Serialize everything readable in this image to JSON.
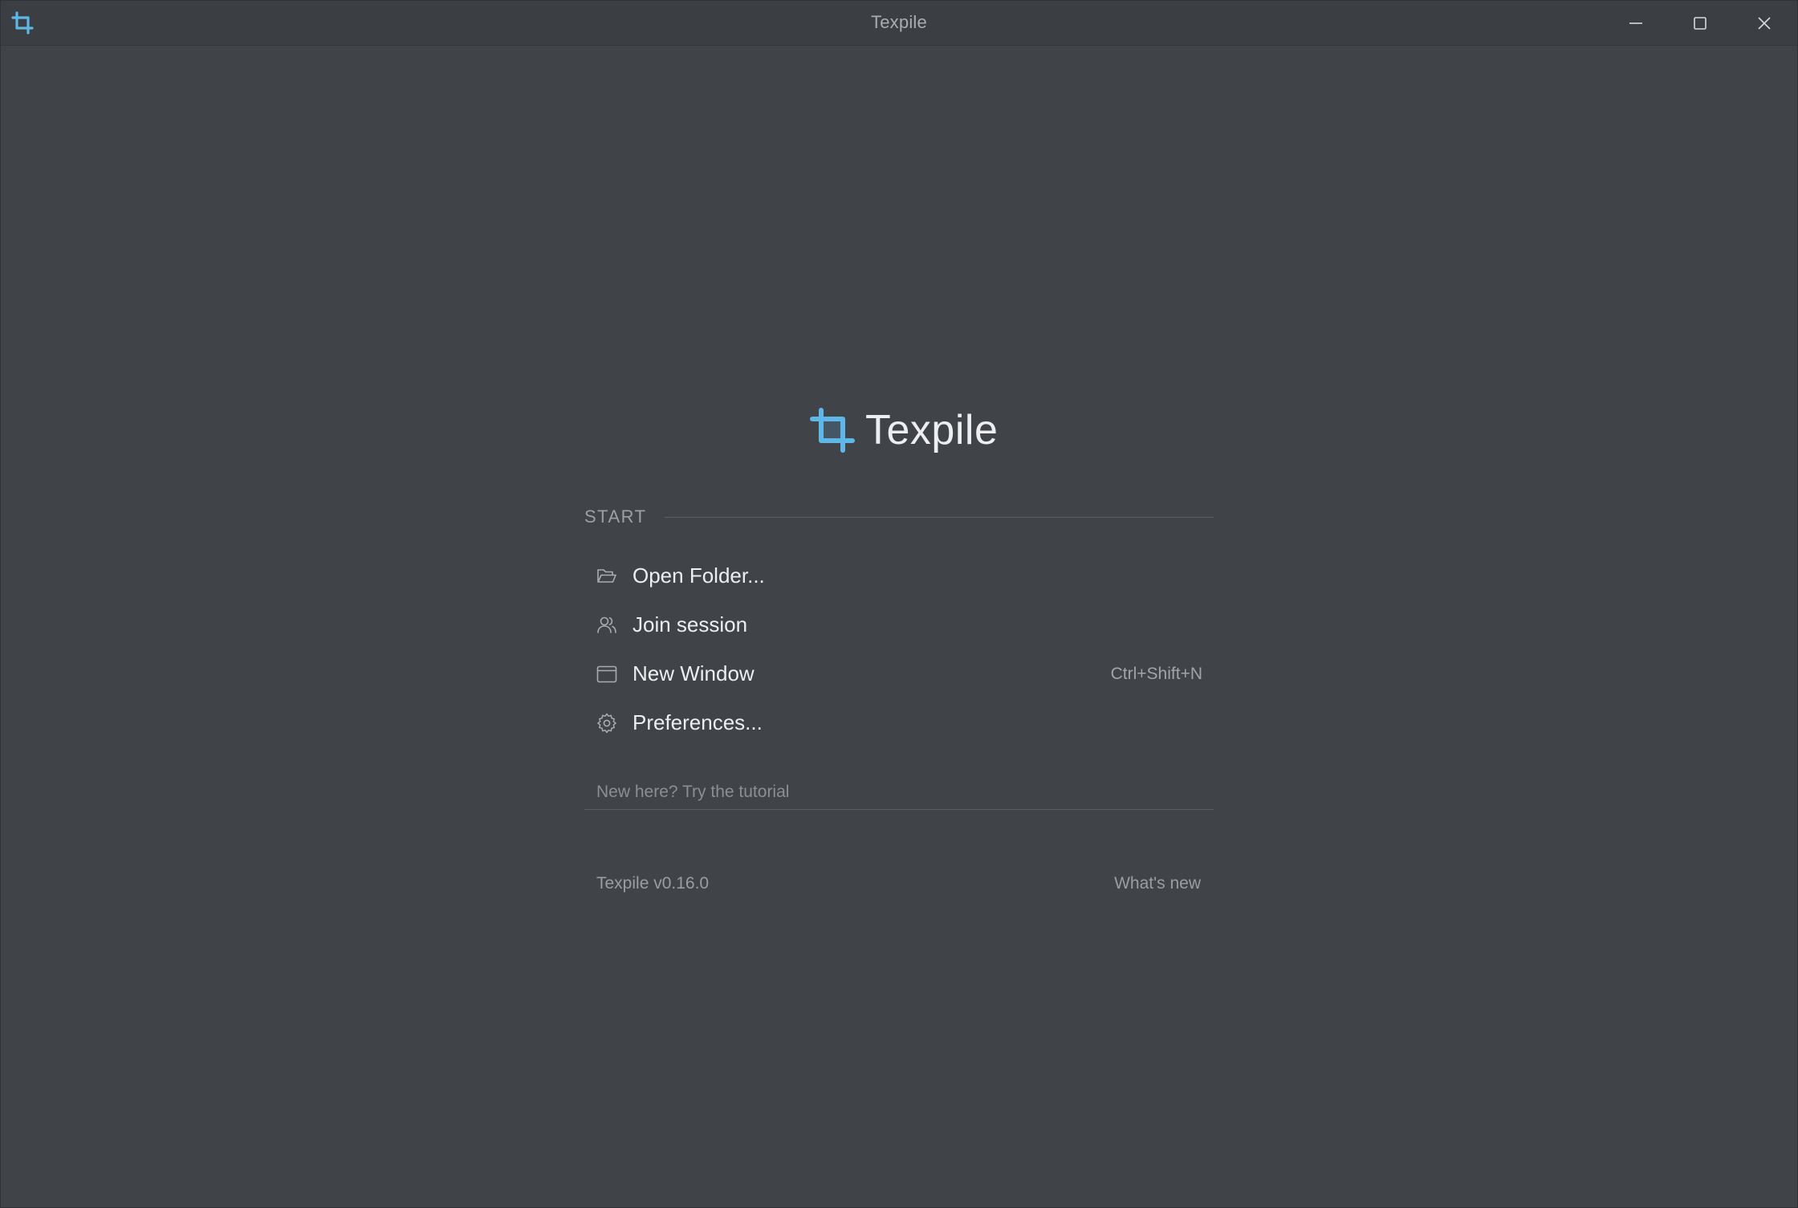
{
  "window": {
    "title": "Texpile",
    "icons": {
      "app": "crop-logo-icon",
      "minimize": "minimize-icon",
      "maximize": "maximize-icon",
      "close": "close-icon"
    }
  },
  "welcome": {
    "app_name": "Texpile",
    "start_section_label": "START",
    "items": [
      {
        "label": "Open Folder...",
        "icon": "folder-open-icon",
        "shortcut": ""
      },
      {
        "label": "Join session",
        "icon": "users-icon",
        "shortcut": ""
      },
      {
        "label": "New Window",
        "icon": "window-icon",
        "shortcut": "Ctrl+Shift+N"
      },
      {
        "label": "Preferences...",
        "icon": "gear-icon",
        "shortcut": ""
      }
    ],
    "tutorial_link": "New here? Try the tutorial",
    "version": "Texpile v0.16.0",
    "whats_new": "What's new"
  },
  "colors": {
    "background": "#404348",
    "titlebar": "#3b3e43",
    "accent": "#5fb7e8",
    "text_primary": "#eceef1",
    "text_muted": "#9a9ea4"
  }
}
